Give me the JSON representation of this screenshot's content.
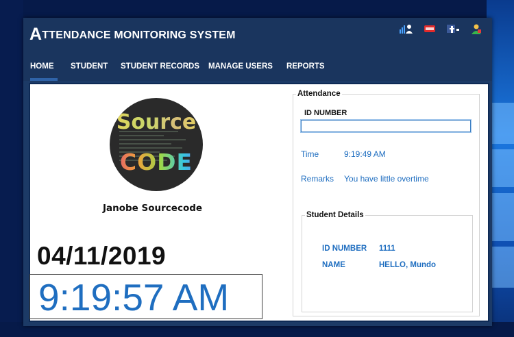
{
  "app": {
    "title_first_letter": "A",
    "title_rest": "TTENDANCE MONITORING SYSTEM"
  },
  "top_icons": [
    "stats-user-icon",
    "youtube-icon",
    "facebook-icon",
    "user-admin-icon"
  ],
  "nav": {
    "items": [
      {
        "label": "HOME",
        "active": true
      },
      {
        "label": "STUDENT",
        "active": false
      },
      {
        "label": "STUDENT RECORDS",
        "active": false
      },
      {
        "label": "MANAGE USERS",
        "active": false
      },
      {
        "label": "REPORTS",
        "active": false
      }
    ]
  },
  "left": {
    "logo_top": "Source",
    "logo_bottom": "CODE",
    "owner": "Janobe Sourcecode",
    "date": "04/11/2019",
    "clock": "9:19:57 AM"
  },
  "attendance": {
    "group_label": "Attendance",
    "id_label": "ID NUMBER",
    "id_value": "",
    "time_label": "Time",
    "time_value": "9:19:49 AM",
    "remarks_label": "Remarks",
    "remarks_value": "You have little overtime"
  },
  "student_details": {
    "group_label": "Student Details",
    "id_label": "ID NUMBER",
    "id_value": "1111",
    "name_label": "NAME",
    "name_value": "HELLO, Mundo"
  },
  "colors": {
    "header_bg": "#1a355e",
    "accent_blue": "#1f6ec0",
    "nav_active_underline": "#2f63a8"
  }
}
